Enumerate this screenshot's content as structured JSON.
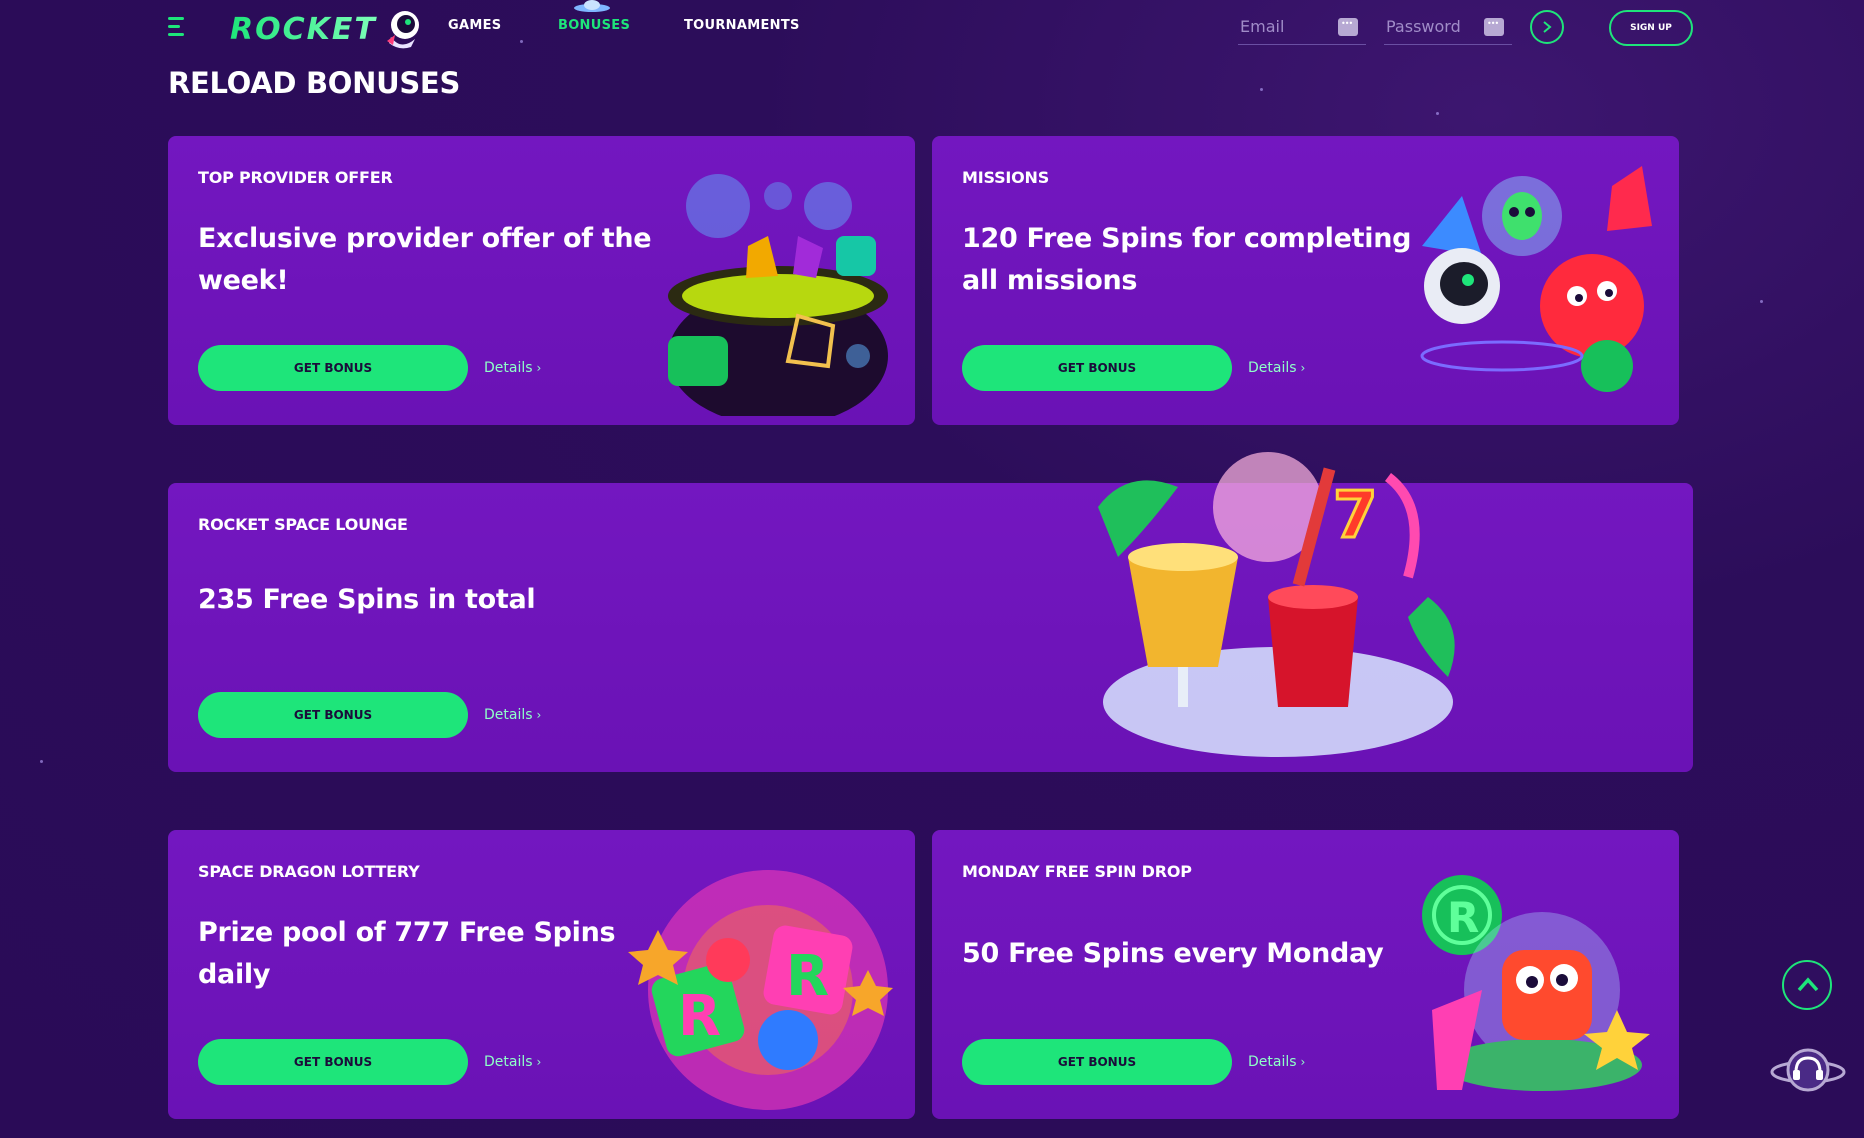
{
  "header": {
    "menu_icon": "hamburger-icon",
    "logo_text": "ROCKET",
    "nav": [
      "GAMES",
      "BONUSES",
      "TOURNAMENTS"
    ],
    "active_nav": "BONUSES",
    "email_placeholder": "Email",
    "password_placeholder": "Password",
    "login_icon": "chevron-right-icon",
    "signup_label": "SIGN UP"
  },
  "page": {
    "title": "RELOAD BONUSES"
  },
  "cards": [
    {
      "label": "TOP PROVIDER OFFER",
      "title_lines": [
        "Exclusive provider offer of the",
        "week!"
      ],
      "button": "GET BONUS",
      "details": "Details",
      "art": "cauldron-gems-art"
    },
    {
      "label": "MISSIONS",
      "title_lines": [
        "120 Free Spins for completing",
        "all missions"
      ],
      "button": "GET BONUS",
      "details": "Details",
      "art": "alien-astronaut-art"
    },
    {
      "label": "ROCKET SPACE LOUNGE",
      "title_lines": [
        "235 Free Spins in total"
      ],
      "button": "GET BONUS",
      "details": "Details",
      "art": "cocktails-art"
    },
    {
      "label": "SPACE DRAGON LOTTERY",
      "title_lines": [
        "Prize pool of 777 Free Spins",
        "daily"
      ],
      "button": "GET BONUS",
      "details": "Details",
      "art": "lottery-art"
    },
    {
      "label": "MONDAY FREE SPIN DROP",
      "title_lines": [
        "50 Free Spins every Monday"
      ],
      "button": "GET BONUS",
      "details": "Details",
      "art": "monster-ufo-art"
    }
  ],
  "floating": {
    "scroll_top_icon": "chevron-up-icon",
    "support_icon": "support-headset-icon"
  },
  "colors": {
    "accent": "#1ee57a",
    "background": "#2a0b57",
    "card": "#7317c0"
  }
}
